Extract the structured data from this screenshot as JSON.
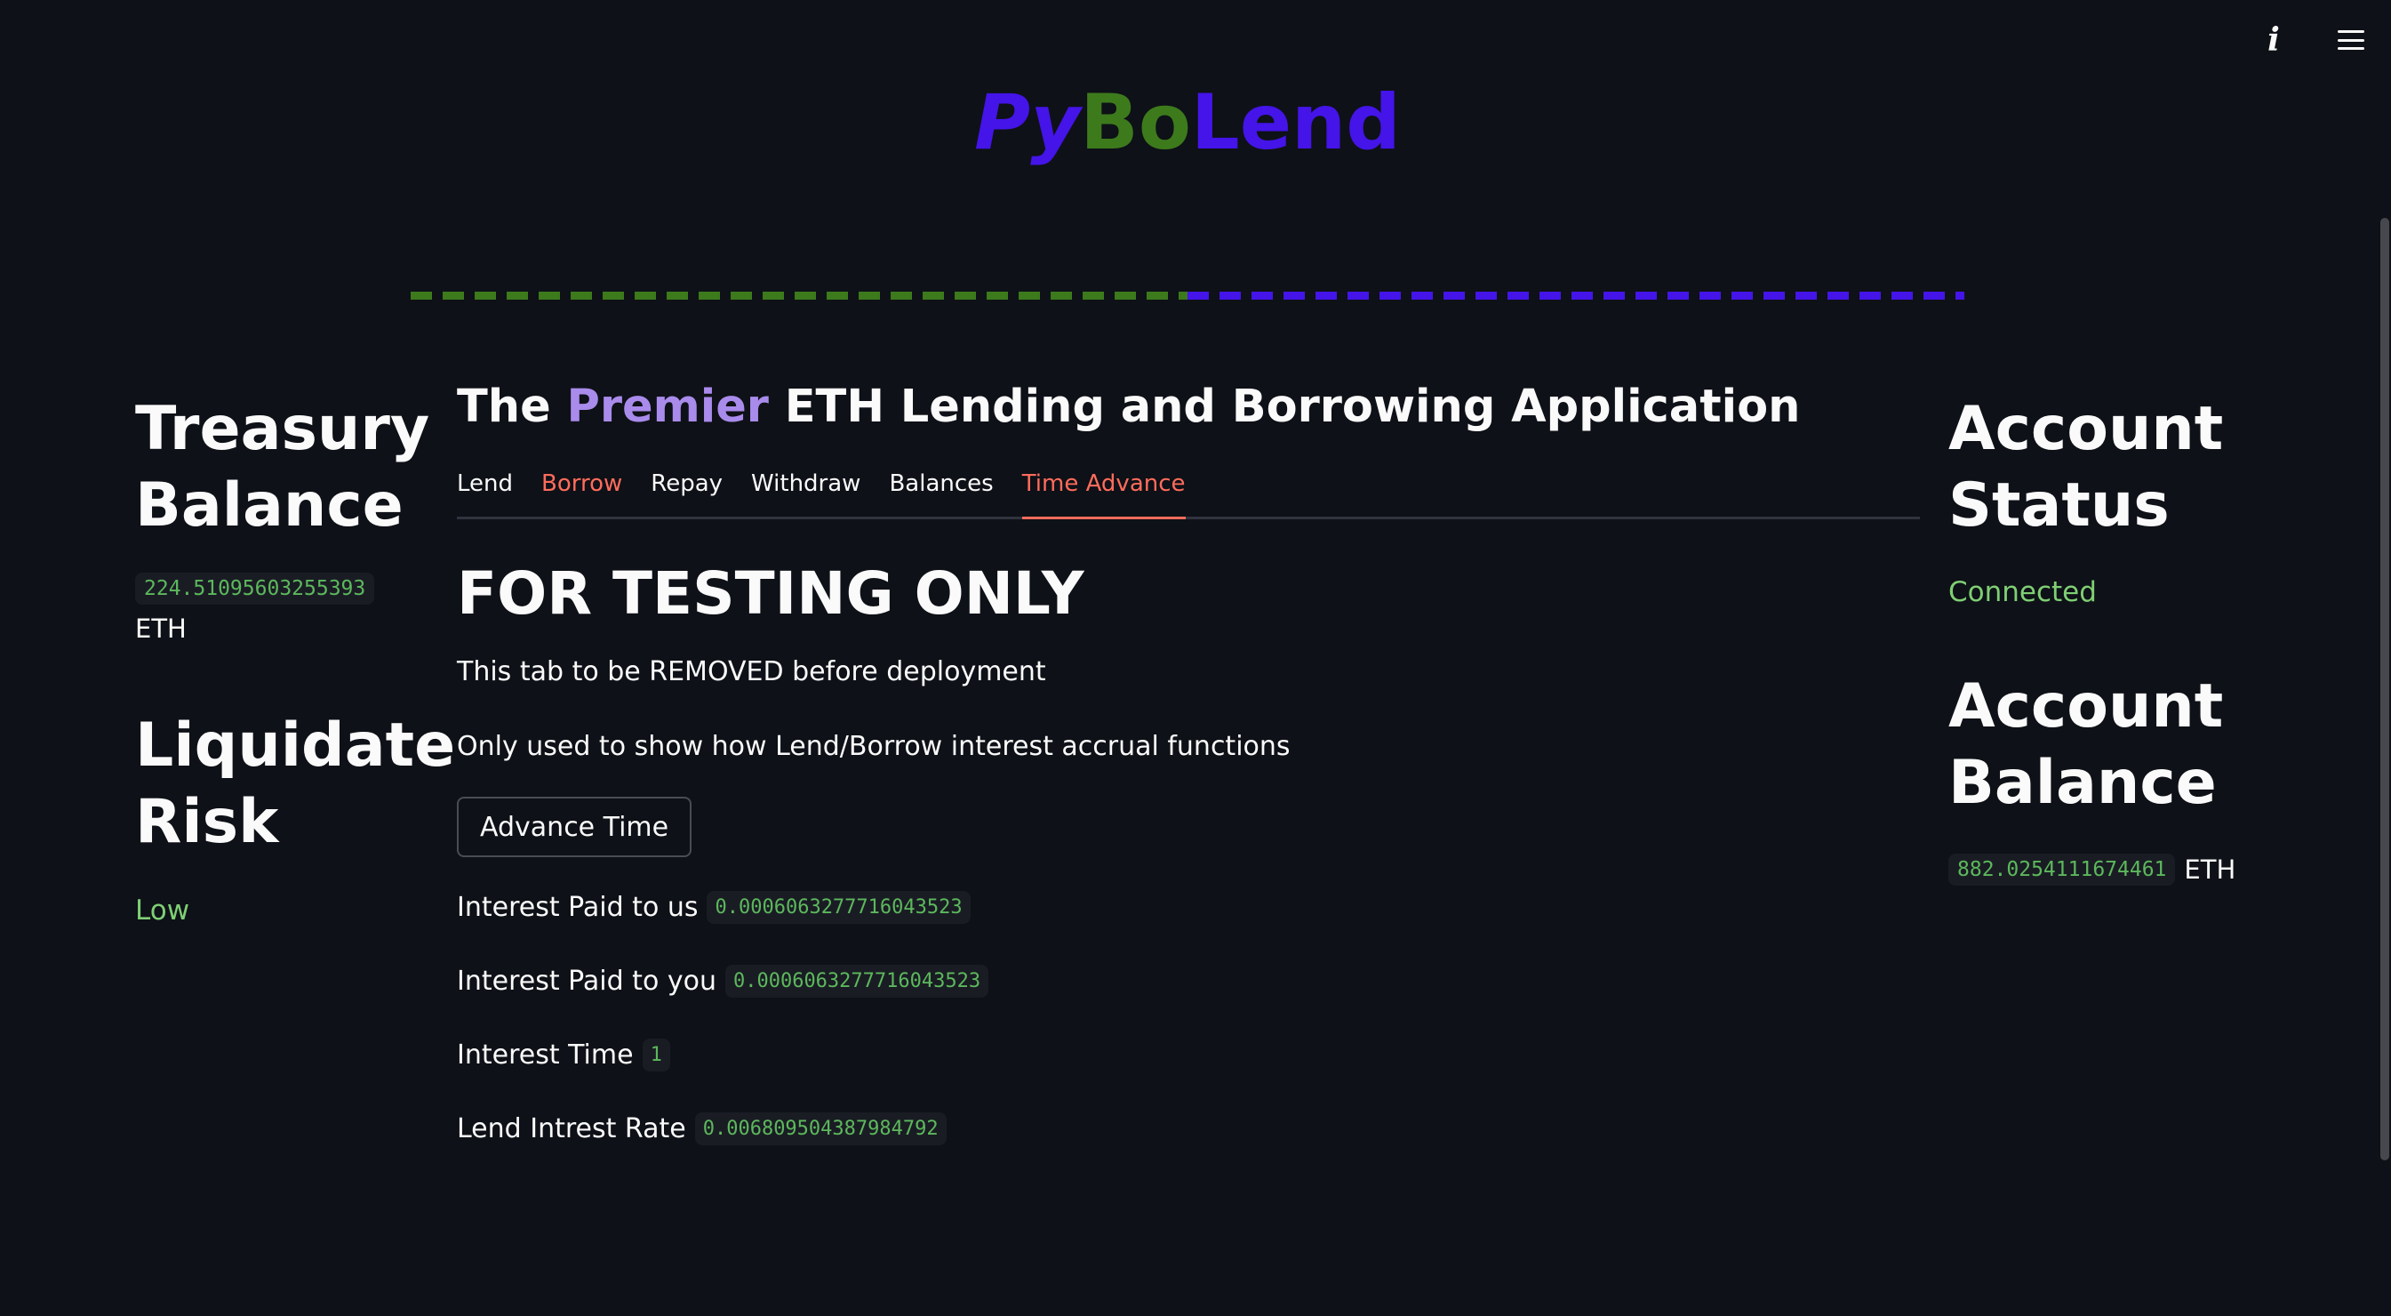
{
  "logo": {
    "part1": "Py",
    "part2": "Bo",
    "part3": "Lend"
  },
  "header": {
    "title_pre": "The ",
    "title_accent": "Premier",
    "title_post": " ETH Lending and Borrowing Application"
  },
  "tabs": [
    {
      "label": "Lend"
    },
    {
      "label": "Borrow"
    },
    {
      "label": "Repay"
    },
    {
      "label": "Withdraw"
    },
    {
      "label": "Balances"
    },
    {
      "label": "Time Advance"
    }
  ],
  "active_tab": "Time Advance",
  "main": {
    "heading": "FOR TESTING ONLY",
    "line1": "This tab to be REMOVED before deployment",
    "line2": "Only used to show how Lend/Borrow interest accrual functions",
    "button_label": "Advance Time",
    "rows": [
      {
        "label": "Interest Paid to us",
        "value": "0.0006063277716043523"
      },
      {
        "label": "Interest Paid to you",
        "value": "0.0006063277716043523"
      },
      {
        "label": "Interest Time",
        "value": "1"
      },
      {
        "label": "Lend Intrest Rate",
        "value": "0.006809504387984792"
      }
    ]
  },
  "treasury": {
    "heading_line1": "Treasury",
    "heading_line2": "Balance",
    "value": "224.51095603255393",
    "unit": "ETH"
  },
  "liquidate": {
    "heading_line1": "Liquidate",
    "heading_line2": "Risk",
    "value": "Low"
  },
  "account_status": {
    "heading_line1": "Account",
    "heading_line2": "Status",
    "value": "Connected"
  },
  "account_balance": {
    "heading_line1": "Account",
    "heading_line2": "Balance",
    "value": "882.0254111674461",
    "unit": "ETH"
  },
  "toolbar": {
    "info_icon": "info-icon",
    "menu_icon": "hamburger-menu-icon"
  },
  "colors": {
    "background": "#0e1117",
    "brand_blue": "#4414e8",
    "brand_green": "#3d7a1c",
    "accent_purple": "#a98beb",
    "tab_active": "#ff6c5c",
    "code_green": "#5cb85c",
    "status_green": "#7fcf74"
  }
}
